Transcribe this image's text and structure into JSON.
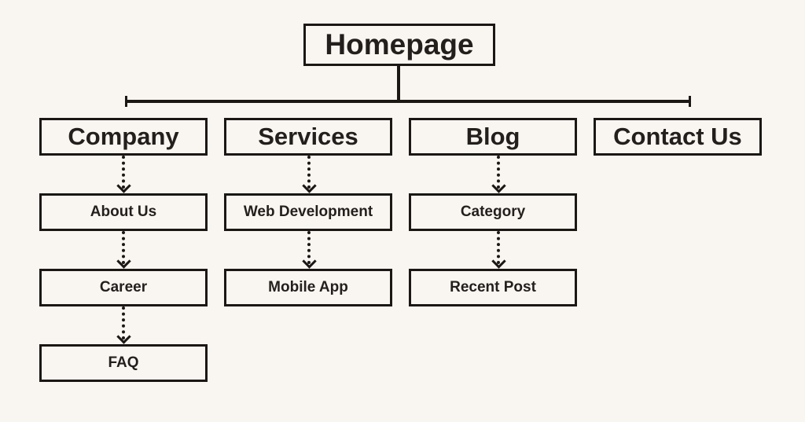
{
  "diagram": {
    "type": "sitemap-tree",
    "root": {
      "label": "Homepage"
    },
    "sections": [
      {
        "label": "Company",
        "children": [
          "About Us",
          "Career",
          "FAQ"
        ]
      },
      {
        "label": "Services",
        "children": [
          "Web Development",
          "Mobile App"
        ]
      },
      {
        "label": "Blog",
        "children": [
          "Category",
          "Recent Post"
        ]
      },
      {
        "label": "Contact Us",
        "children": []
      }
    ],
    "colors": {
      "background": "#f9f6f2",
      "stroke": "#1a1714",
      "text": "#231f1c"
    }
  }
}
